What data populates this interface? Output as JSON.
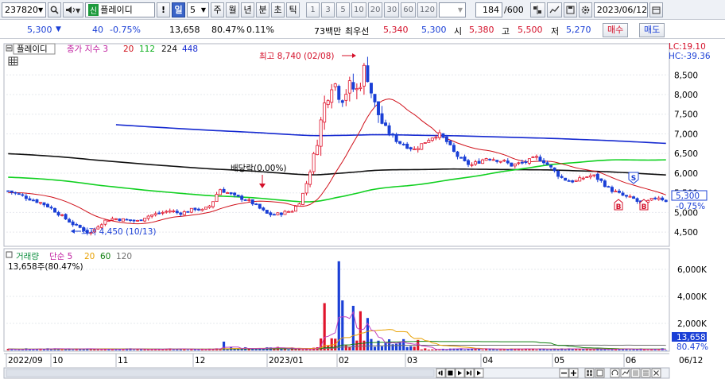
{
  "toolbar": {
    "code": "237820",
    "market_badge": "신",
    "stock_name": "플레이디",
    "alert_label": "!",
    "period_active": "일",
    "period_num": "5",
    "periods": [
      "주",
      "월",
      "년",
      "분",
      "초",
      "틱"
    ],
    "intervals": [
      "1",
      "3",
      "5",
      "10",
      "20",
      "30",
      "60",
      "120"
    ],
    "count": "184",
    "count_total": "/600",
    "date": "2023/06/12"
  },
  "quote": {
    "price": "5,300",
    "change": "40",
    "change_pct": "-0.75%",
    "volume": "13,658",
    "volume_ratio": "80.47%",
    "turnover": "0.11%",
    "trade_value": "73백만",
    "best_label": "최우선",
    "best_ask": "5,340",
    "best_bid": "5,300",
    "open_label": "시",
    "open": "5,380",
    "high_label": "고",
    "high": "5,500",
    "low_label": "저",
    "low": "5,270",
    "buy_label": "매수",
    "sell_label": "매도"
  },
  "price_panel": {
    "stock_label": "플레이디",
    "ma_label": "종가 지수 3",
    "ma_periods": [
      "20",
      "112",
      "224",
      "448"
    ],
    "lc_label": "LC:19.10",
    "hc_label": "HC:-39.36",
    "high_annotation": "최고 8,740 (02/08)",
    "low_annotation": "최저 4,450 (10/13)",
    "dividend_annotation": "배당락(0.00%)",
    "marker_s": "S",
    "marker_b": "B",
    "current_price": "5,300",
    "current_pct": "-0.75%"
  },
  "volume_panel": {
    "title": "거래량",
    "ma_label": "단순 5",
    "ma_periods": [
      "20",
      "60",
      "120"
    ],
    "current_label": "13,658주(80.47%)",
    "current_value": "13,658",
    "current_pct": "80.47%"
  },
  "x_axis": {
    "labels": [
      "2022/09",
      "10",
      "11",
      "12",
      "2023/01",
      "02",
      "03",
      "04",
      "05",
      "06"
    ],
    "end_label": "06/12"
  },
  "colors": {
    "up": "#e0142c",
    "down": "#1a3fd6",
    "ma20": "#d0101a",
    "ma112": "#10d020",
    "ma224": "#101010",
    "ma448": "#1428d0",
    "vol_ma5": "#c040c0",
    "vol_ma20": "#e8a000",
    "vol_ma60": "#108010",
    "vol_ma120": "#707070"
  },
  "chart_data": [
    {
      "type": "candlestick",
      "title": "플레이디",
      "y_ticks": [
        4500,
        5000,
        5500,
        6000,
        6500,
        7000,
        7500,
        8000,
        8500
      ],
      "ylim": [
        4180,
        8950
      ],
      "x_labels": [
        "2022/09",
        "10",
        "11",
        "12",
        "2023/01",
        "02",
        "03",
        "04",
        "05",
        "06"
      ],
      "key_points": [
        {
          "date": "2022/10/13",
          "close": 4450,
          "label": "최저 4,450 (10/13)"
        },
        {
          "date": "2023/02/08",
          "close": 8740,
          "label": "최고 8,740 (02/08)"
        },
        {
          "date": "2023/06/12",
          "close": 5300
        }
      ],
      "close_path": [
        5550,
        5480,
        5400,
        5320,
        5250,
        5150,
        5000,
        4850,
        4700,
        4600,
        4450,
        4650,
        4800,
        4850,
        4820,
        4800,
        4780,
        4900,
        4950,
        5000,
        5050,
        4980,
        5020,
        5100,
        5050,
        5200,
        5600,
        5500,
        5400,
        5350,
        5250,
        5100,
        4950,
        4950,
        5000,
        5050,
        5300,
        5900,
        6800,
        7800,
        8400,
        7900,
        8200,
        8100,
        8740,
        7800,
        7300,
        7000,
        6800,
        6700,
        6600,
        6750,
        6900,
        7000,
        6800,
        6500,
        6300,
        6200,
        6300,
        6400,
        6350,
        6300,
        6200,
        6250,
        6300,
        6400,
        6300,
        6100,
        5900,
        5800,
        5800,
        5900,
        5950,
        5800,
        5600,
        5500,
        5400,
        5350,
        5200,
        5300,
        5400,
        5300
      ]
    },
    {
      "type": "bar",
      "title": "거래량",
      "y_ticks": [
        2000,
        4000,
        6000
      ],
      "y_tick_labels": [
        "2,000K",
        "4,000K",
        "6,000K"
      ],
      "ylim": [
        0,
        7000
      ],
      "unit": "K",
      "big_bars": [
        {
          "period": "2023/01 late",
          "value": 3500
        },
        {
          "period": "2023/02 early",
          "value": 6600
        },
        {
          "period": "2023/02 early",
          "value": 3700
        },
        {
          "period": "2023/02 mid",
          "value": 3300
        },
        {
          "period": "2023/02 mid",
          "value": 2900
        },
        {
          "period": "2023/02 mid",
          "value": 2400
        }
      ],
      "latest": 13.658
    }
  ]
}
